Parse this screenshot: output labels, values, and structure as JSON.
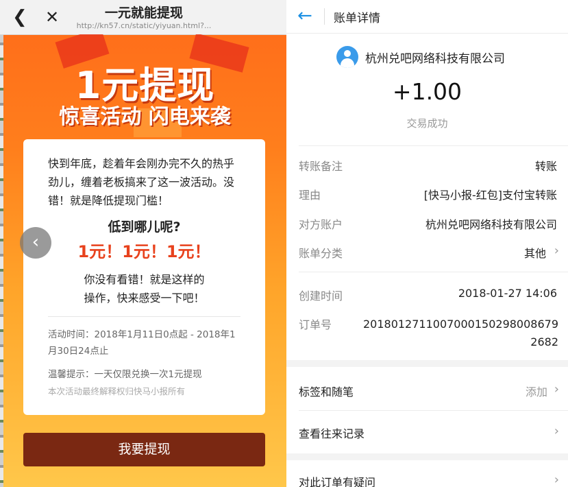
{
  "left": {
    "header": {
      "title": "一元就能提现",
      "url": "http://kn57.cn/static/yiyuan.html?...",
      "back_icon": "chevron-left-icon",
      "close_icon": "close-icon"
    },
    "banner": {
      "title": "1元提现",
      "subtitle": "惊喜活动 闪电来袭"
    },
    "card": {
      "intro": "快到年底，趁着年会刚办完不久的热乎劲儿，缠着老板搞来了这一波活动。没错！就是降低提现门槛！",
      "question": "低到哪儿呢?",
      "highlight": "1元！1元！1元！",
      "line1": "你没有看错！就是这样的",
      "line2": "操作，快来感受一下吧！",
      "activity_time": "活动时间：2018年1月11日0点起 - 2018年1月30日24点止",
      "tip": "温馨提示：一天仅限兑换一次1元提现",
      "note": "本次活动最终解释权归快马小报所有"
    },
    "prev_arrow": "‹",
    "button_label": "我要提现"
  },
  "right": {
    "header": {
      "title": "账单详情",
      "back_icon": "arrow-left-icon"
    },
    "payee": "杭州兑吧网络科技有限公司",
    "amount": "+1.00",
    "status": "交易成功",
    "details": [
      {
        "label": "转账备注",
        "value": "转账"
      },
      {
        "label": "理由",
        "value": "[快马小报-红包]支付宝转账"
      },
      {
        "label": "对方账户",
        "value": "杭州兑吧网络科技有限公司"
      },
      {
        "label": "账单分类",
        "value": "其他"
      }
    ],
    "created": {
      "label": "创建时间",
      "value": "2018-01-27 14:06"
    },
    "order": {
      "label": "订单号",
      "value": "2018012711007000150298008679 2682"
    },
    "actions": {
      "tags_label": "标签和随笔",
      "tags_action": "添加",
      "history_label": "查看往来记录",
      "question_label": "对此订单有疑问"
    },
    "colors": {
      "accent": "#1a8fe3",
      "avatar": "#3a9bea"
    }
  }
}
